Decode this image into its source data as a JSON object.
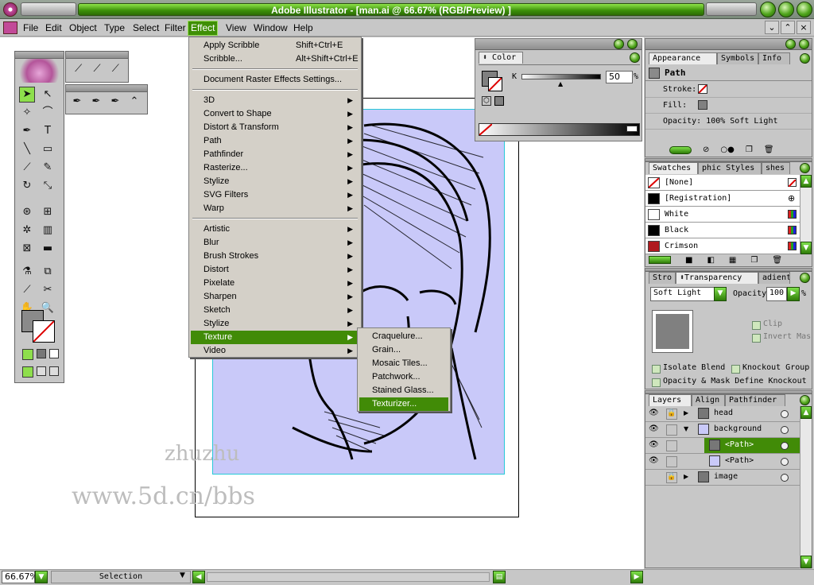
{
  "window": {
    "title": "Adobe Illustrator - [man.ai @ 66.67% (RGB/Preview) ]"
  },
  "menubar": {
    "items": [
      "File",
      "Edit",
      "Object",
      "Type",
      "Select",
      "Filter",
      "Effect",
      "View",
      "Window",
      "Help"
    ],
    "active": "Effect"
  },
  "effect_menu": {
    "items": [
      {
        "label": "Apply Scribble",
        "shortcut": "Shift+Ctrl+E"
      },
      {
        "label": "Scribble...",
        "shortcut": "Alt+Shift+Ctrl+E"
      },
      {
        "label": "Document Raster Effects Settings..."
      },
      {
        "label": "3D"
      },
      {
        "label": "Convert to Shape"
      },
      {
        "label": "Distort & Transform"
      },
      {
        "label": "Path"
      },
      {
        "label": "Pathfinder"
      },
      {
        "label": "Rasterize..."
      },
      {
        "label": "Stylize"
      },
      {
        "label": "SVG Filters"
      },
      {
        "label": "Warp"
      },
      {
        "label": "Artistic"
      },
      {
        "label": "Blur"
      },
      {
        "label": "Brush Strokes"
      },
      {
        "label": "Distort"
      },
      {
        "label": "Pixelate"
      },
      {
        "label": "Sharpen"
      },
      {
        "label": "Sketch"
      },
      {
        "label": "Stylize"
      },
      {
        "label": "Texture"
      },
      {
        "label": "Video"
      }
    ],
    "highlighted": "Texture"
  },
  "texture_submenu": {
    "items": [
      "Craquelure...",
      "Grain...",
      "Mosaic Tiles...",
      "Patchwork...",
      "Stained Glass...",
      "Texturizer..."
    ],
    "highlighted": "Texturizer..."
  },
  "color_panel": {
    "tab": "Color",
    "channel": "K",
    "value": "50",
    "unit": "%"
  },
  "appearance_panel": {
    "tabs": [
      "Appearance",
      "Symbols",
      "Info"
    ],
    "item": "Path",
    "stroke_label": "Stroke:",
    "fill_label": "Fill:",
    "opacity_line": "Opacity: 100% Soft Light"
  },
  "swatches_panel": {
    "tabs": [
      "Swatches",
      "phic Styles",
      "shes"
    ],
    "items": [
      {
        "name": "[None]",
        "color": "#ffffff"
      },
      {
        "name": "[Registration]",
        "color": "#000000"
      },
      {
        "name": "White",
        "color": "#ffffff"
      },
      {
        "name": "Black",
        "color": "#000000"
      },
      {
        "name": "Crimson",
        "color": "#b0191e"
      }
    ]
  },
  "transparency_panel": {
    "tabs": [
      "Stro",
      "Transparency",
      "adient"
    ],
    "blend_mode": "Soft Light",
    "opacity_label": "Opacity:",
    "opacity_value": "100",
    "opacity_unit": "%",
    "clip": "Clip",
    "invert_mask": "Invert Mas",
    "isolate_blend": "Isolate Blend",
    "knockout_group": "Knockout Group",
    "opacity_mask": "Opacity & Mask Define Knockout"
  },
  "layers_panel": {
    "tabs": [
      "Layers",
      "Align",
      "Pathfinder"
    ],
    "items": [
      {
        "name": "head"
      },
      {
        "name": "background"
      },
      {
        "name": "<Path>"
      },
      {
        "name": "<Path>"
      },
      {
        "name": "image"
      }
    ]
  },
  "statusbar": {
    "zoom": "66.67%",
    "mode": "Selection"
  },
  "watermark": {
    "line1": "zhuzhu",
    "line2": "www.5d.cn/bbs"
  },
  "colors": {
    "accent": "#3f8f06",
    "selection_bg": "#c9c9f9",
    "highlight": "#8edf4c"
  }
}
